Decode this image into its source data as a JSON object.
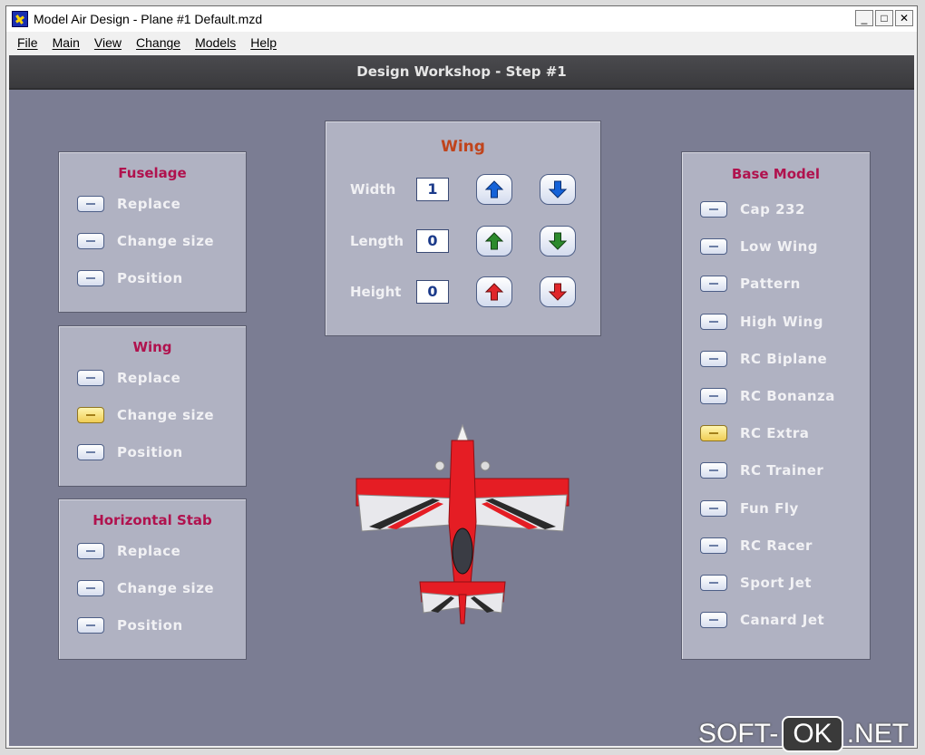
{
  "window": {
    "title": "Model Air Design - Plane #1  Default.mzd"
  },
  "menu": [
    "File",
    "Main",
    "View",
    "Change",
    "Models",
    "Help"
  ],
  "header": {
    "title": "Design Workshop  -  Step #1"
  },
  "fuselage": {
    "title": "Fuselage",
    "options": [
      "Replace",
      "Change size",
      "Position"
    ]
  },
  "wing_panel": {
    "title": "Wing",
    "options": [
      "Replace",
      "Change size",
      "Position"
    ],
    "active_index": 1
  },
  "hstab": {
    "title": "Horizontal Stab",
    "options": [
      "Replace",
      "Change size",
      "Position"
    ]
  },
  "wing_editor": {
    "title": "Wing",
    "rows": [
      {
        "label": "Width",
        "value": "1",
        "color": "#1462d8"
      },
      {
        "label": "Length",
        "value": "0",
        "color": "#2c8a2c"
      },
      {
        "label": "Height",
        "value": "0",
        "color": "#e0262a"
      }
    ]
  },
  "base_model": {
    "title": "Base Model",
    "models": [
      "Cap 232",
      "Low Wing",
      "Pattern",
      "High Wing",
      "RC Biplane",
      "RC Bonanza",
      "RC Extra",
      "RC Trainer",
      "Fun Fly",
      "RC Racer",
      "Sport Jet",
      "Canard Jet"
    ],
    "active_index": 6
  },
  "watermark": {
    "left": "SOFT-",
    "ok": "OK",
    "right": ".NET"
  },
  "colors": {
    "accent_title": "#b0124e",
    "wing_title": "#c0441c",
    "active_button": "#f0cd55"
  },
  "icons": {
    "up": "arrow-up-icon",
    "down": "arrow-down-icon",
    "plane": "airplane-model-preview"
  }
}
